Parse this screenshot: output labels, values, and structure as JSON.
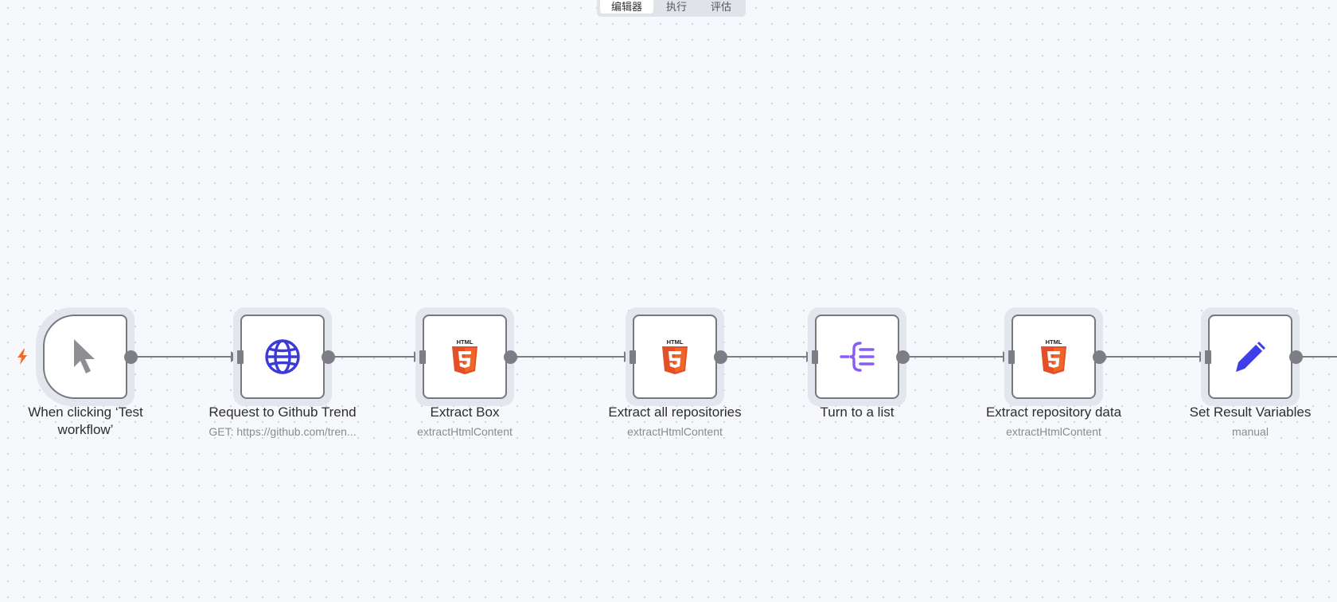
{
  "tabs": [
    {
      "label": "编辑器",
      "active": true
    },
    {
      "label": "执行",
      "active": false
    },
    {
      "label": "评估",
      "active": false
    }
  ],
  "nodes": [
    {
      "name": "When clicking ‘Test workflow’",
      "subtitle": "",
      "icon": "cursor-icon"
    },
    {
      "name": "Request to Github Trend",
      "subtitle": "GET: https://github.com/tren...",
      "icon": "globe-icon"
    },
    {
      "name": "Extract Box",
      "subtitle": "extractHtmlContent",
      "icon": "html5-icon"
    },
    {
      "name": "Extract all repositories",
      "subtitle": "extractHtmlContent",
      "icon": "html5-icon"
    },
    {
      "name": "Turn to a list",
      "subtitle": "",
      "icon": "split-list-icon"
    },
    {
      "name": "Extract repository data",
      "subtitle": "extractHtmlContent",
      "icon": "html5-icon"
    },
    {
      "name": "Set Result Variables",
      "subtitle": "manual",
      "icon": "pencil-icon"
    }
  ],
  "colors": {
    "html5": "#e34f26",
    "globe": "#3b3bd6",
    "split": "#8a5cf6",
    "pencil": "#3d3dea",
    "bolt": "#f06a2a",
    "edge": "#7d7d86"
  }
}
